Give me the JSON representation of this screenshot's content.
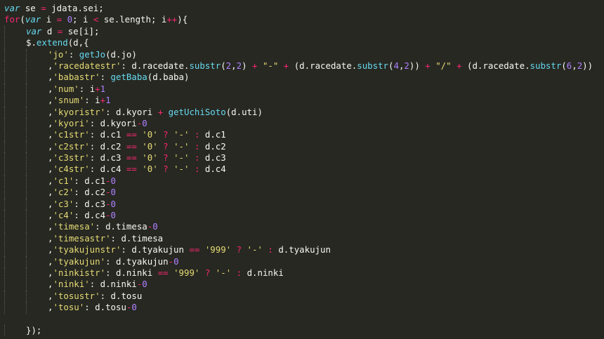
{
  "editor": {
    "theme": {
      "background": "#272822",
      "foreground": "#f8f8f2",
      "keyword": "#66d9ef",
      "control": "#f92672",
      "string": "#e6db74",
      "number": "#ae81ff",
      "function": "#66d9ef"
    },
    "lines": [
      {
        "indent": 0,
        "tokens": [
          [
            "kw",
            "var"
          ],
          [
            "id",
            " se "
          ],
          [
            "op",
            "="
          ],
          [
            "id",
            " jdata.sei;"
          ]
        ]
      },
      {
        "indent": 0,
        "tokens": [
          [
            "ctl",
            "for"
          ],
          [
            "id",
            "("
          ],
          [
            "kw",
            "var"
          ],
          [
            "id",
            " i "
          ],
          [
            "op",
            "="
          ],
          [
            "id",
            " "
          ],
          [
            "num",
            "0"
          ],
          [
            "id",
            "; i "
          ],
          [
            "op",
            "<"
          ],
          [
            "id",
            " se.length; i"
          ],
          [
            "op",
            "++"
          ],
          [
            "id",
            "){"
          ]
        ]
      },
      {
        "indent": 1,
        "tokens": [
          [
            "kw",
            "var"
          ],
          [
            "id",
            " d "
          ],
          [
            "op",
            "="
          ],
          [
            "id",
            " se[i];"
          ]
        ]
      },
      {
        "indent": 1,
        "tokens": [
          [
            "id",
            "$."
          ],
          [
            "fn",
            "extend"
          ],
          [
            "id",
            "(d,{"
          ]
        ]
      },
      {
        "indent": 2,
        "tokens": [
          [
            "str",
            "'jo'"
          ],
          [
            "id",
            ": "
          ],
          [
            "fn",
            "getJo"
          ],
          [
            "id",
            "(d.jo)"
          ]
        ]
      },
      {
        "indent": 2,
        "tokens": [
          [
            "id",
            ","
          ],
          [
            "str",
            "'racedatestr'"
          ],
          [
            "id",
            ": d.racedate."
          ],
          [
            "fn",
            "substr"
          ],
          [
            "id",
            "("
          ],
          [
            "num",
            "2"
          ],
          [
            "id",
            ","
          ],
          [
            "num",
            "2"
          ],
          [
            "id",
            ") "
          ],
          [
            "op",
            "+"
          ],
          [
            "id",
            " "
          ],
          [
            "str",
            "\"-\""
          ],
          [
            "id",
            " "
          ],
          [
            "op",
            "+"
          ],
          [
            "id",
            " (d.racedate."
          ],
          [
            "fn",
            "substr"
          ],
          [
            "id",
            "("
          ],
          [
            "num",
            "4"
          ],
          [
            "id",
            ","
          ],
          [
            "num",
            "2"
          ],
          [
            "id",
            ")) "
          ],
          [
            "op",
            "+"
          ],
          [
            "id",
            " "
          ],
          [
            "str",
            "\"/\""
          ],
          [
            "id",
            " "
          ],
          [
            "op",
            "+"
          ],
          [
            "id",
            " (d.racedate."
          ],
          [
            "fn",
            "substr"
          ],
          [
            "id",
            "("
          ],
          [
            "num",
            "6"
          ],
          [
            "id",
            ","
          ],
          [
            "num",
            "2"
          ],
          [
            "id",
            "))"
          ]
        ]
      },
      {
        "indent": 2,
        "tokens": [
          [
            "id",
            ","
          ],
          [
            "str",
            "'babastr'"
          ],
          [
            "id",
            ": "
          ],
          [
            "fn",
            "getBaba"
          ],
          [
            "id",
            "(d.baba)"
          ]
        ]
      },
      {
        "indent": 2,
        "tokens": [
          [
            "id",
            ","
          ],
          [
            "str",
            "'num'"
          ],
          [
            "id",
            ": i"
          ],
          [
            "op",
            "+"
          ],
          [
            "num",
            "1"
          ]
        ]
      },
      {
        "indent": 2,
        "tokens": [
          [
            "id",
            ","
          ],
          [
            "str",
            "'snum'"
          ],
          [
            "id",
            ": i"
          ],
          [
            "op",
            "+"
          ],
          [
            "num",
            "1"
          ]
        ]
      },
      {
        "indent": 2,
        "tokens": [
          [
            "id",
            ","
          ],
          [
            "str",
            "'kyoristr'"
          ],
          [
            "id",
            ": d.kyori "
          ],
          [
            "op",
            "+"
          ],
          [
            "id",
            " "
          ],
          [
            "fn",
            "getUchiSoto"
          ],
          [
            "id",
            "(d.uti)"
          ]
        ]
      },
      {
        "indent": 2,
        "tokens": [
          [
            "id",
            ","
          ],
          [
            "str",
            "'kyori'"
          ],
          [
            "id",
            ": d.kyori"
          ],
          [
            "op",
            "-"
          ],
          [
            "num",
            "0"
          ]
        ]
      },
      {
        "indent": 2,
        "tokens": [
          [
            "id",
            ","
          ],
          [
            "str",
            "'c1str'"
          ],
          [
            "id",
            ": d.c1 "
          ],
          [
            "op",
            "=="
          ],
          [
            "id",
            " "
          ],
          [
            "str",
            "'0'"
          ],
          [
            "id",
            " "
          ],
          [
            "op",
            "?"
          ],
          [
            "id",
            " "
          ],
          [
            "str",
            "'-'"
          ],
          [
            "id",
            " "
          ],
          [
            "op",
            ":"
          ],
          [
            "id",
            " d.c1"
          ]
        ]
      },
      {
        "indent": 2,
        "tokens": [
          [
            "id",
            ","
          ],
          [
            "str",
            "'c2str'"
          ],
          [
            "id",
            ": d.c2 "
          ],
          [
            "op",
            "=="
          ],
          [
            "id",
            " "
          ],
          [
            "str",
            "'0'"
          ],
          [
            "id",
            " "
          ],
          [
            "op",
            "?"
          ],
          [
            "id",
            " "
          ],
          [
            "str",
            "'-'"
          ],
          [
            "id",
            " "
          ],
          [
            "op",
            ":"
          ],
          [
            "id",
            " d.c2"
          ]
        ]
      },
      {
        "indent": 2,
        "tokens": [
          [
            "id",
            ","
          ],
          [
            "str",
            "'c3str'"
          ],
          [
            "id",
            ": d.c3 "
          ],
          [
            "op",
            "=="
          ],
          [
            "id",
            " "
          ],
          [
            "str",
            "'0'"
          ],
          [
            "id",
            " "
          ],
          [
            "op",
            "?"
          ],
          [
            "id",
            " "
          ],
          [
            "str",
            "'-'"
          ],
          [
            "id",
            " "
          ],
          [
            "op",
            ":"
          ],
          [
            "id",
            " d.c3"
          ]
        ]
      },
      {
        "indent": 2,
        "tokens": [
          [
            "id",
            ","
          ],
          [
            "str",
            "'c4str'"
          ],
          [
            "id",
            ": d.c4 "
          ],
          [
            "op",
            "=="
          ],
          [
            "id",
            " "
          ],
          [
            "str",
            "'0'"
          ],
          [
            "id",
            " "
          ],
          [
            "op",
            "?"
          ],
          [
            "id",
            " "
          ],
          [
            "str",
            "'-'"
          ],
          [
            "id",
            " "
          ],
          [
            "op",
            ":"
          ],
          [
            "id",
            " d.c4"
          ]
        ]
      },
      {
        "indent": 2,
        "tokens": [
          [
            "id",
            ","
          ],
          [
            "str",
            "'c1'"
          ],
          [
            "id",
            ": d.c1"
          ],
          [
            "op",
            "-"
          ],
          [
            "num",
            "0"
          ]
        ]
      },
      {
        "indent": 2,
        "tokens": [
          [
            "id",
            ","
          ],
          [
            "str",
            "'c2'"
          ],
          [
            "id",
            ": d.c2"
          ],
          [
            "op",
            "-"
          ],
          [
            "num",
            "0"
          ]
        ]
      },
      {
        "indent": 2,
        "tokens": [
          [
            "id",
            ","
          ],
          [
            "str",
            "'c3'"
          ],
          [
            "id",
            ": d.c3"
          ],
          [
            "op",
            "-"
          ],
          [
            "num",
            "0"
          ]
        ]
      },
      {
        "indent": 2,
        "tokens": [
          [
            "id",
            ","
          ],
          [
            "str",
            "'c4'"
          ],
          [
            "id",
            ": d.c4"
          ],
          [
            "op",
            "-"
          ],
          [
            "num",
            "0"
          ]
        ]
      },
      {
        "indent": 2,
        "tokens": [
          [
            "id",
            ","
          ],
          [
            "str",
            "'timesa'"
          ],
          [
            "id",
            ": d.timesa"
          ],
          [
            "op",
            "-"
          ],
          [
            "num",
            "0"
          ]
        ]
      },
      {
        "indent": 2,
        "tokens": [
          [
            "id",
            ","
          ],
          [
            "str",
            "'timesastr'"
          ],
          [
            "id",
            ": d.timesa"
          ]
        ]
      },
      {
        "indent": 2,
        "tokens": [
          [
            "id",
            ","
          ],
          [
            "str",
            "'tyakujunstr'"
          ],
          [
            "id",
            ": d.tyakujun "
          ],
          [
            "op",
            "=="
          ],
          [
            "id",
            " "
          ],
          [
            "str",
            "'999'"
          ],
          [
            "id",
            " "
          ],
          [
            "op",
            "?"
          ],
          [
            "id",
            " "
          ],
          [
            "str",
            "'-'"
          ],
          [
            "id",
            " "
          ],
          [
            "op",
            ":"
          ],
          [
            "id",
            " d.tyakujun"
          ]
        ]
      },
      {
        "indent": 2,
        "tokens": [
          [
            "id",
            ","
          ],
          [
            "str",
            "'tyakujun'"
          ],
          [
            "id",
            ": d.tyakujun"
          ],
          [
            "op",
            "-"
          ],
          [
            "num",
            "0"
          ]
        ]
      },
      {
        "indent": 2,
        "tokens": [
          [
            "id",
            ","
          ],
          [
            "str",
            "'ninkistr'"
          ],
          [
            "id",
            ": d.ninki "
          ],
          [
            "op",
            "=="
          ],
          [
            "id",
            " "
          ],
          [
            "str",
            "'999'"
          ],
          [
            "id",
            " "
          ],
          [
            "op",
            "?"
          ],
          [
            "id",
            " "
          ],
          [
            "str",
            "'-'"
          ],
          [
            "id",
            " "
          ],
          [
            "op",
            ":"
          ],
          [
            "id",
            " d.ninki"
          ]
        ]
      },
      {
        "indent": 2,
        "tokens": [
          [
            "id",
            ","
          ],
          [
            "str",
            "'ninki'"
          ],
          [
            "id",
            ": d.ninki"
          ],
          [
            "op",
            "-"
          ],
          [
            "num",
            "0"
          ]
        ]
      },
      {
        "indent": 2,
        "tokens": [
          [
            "id",
            ","
          ],
          [
            "str",
            "'tosustr'"
          ],
          [
            "id",
            ": d.tosu"
          ]
        ]
      },
      {
        "indent": 2,
        "tokens": [
          [
            "id",
            ","
          ],
          [
            "str",
            "'tosu'"
          ],
          [
            "id",
            ": d.tosu"
          ],
          [
            "op",
            "-"
          ],
          [
            "num",
            "0"
          ]
        ]
      },
      {
        "indent": 0,
        "tokens": []
      },
      {
        "indent": 1,
        "tokens": [
          [
            "id",
            "});"
          ]
        ]
      }
    ]
  }
}
